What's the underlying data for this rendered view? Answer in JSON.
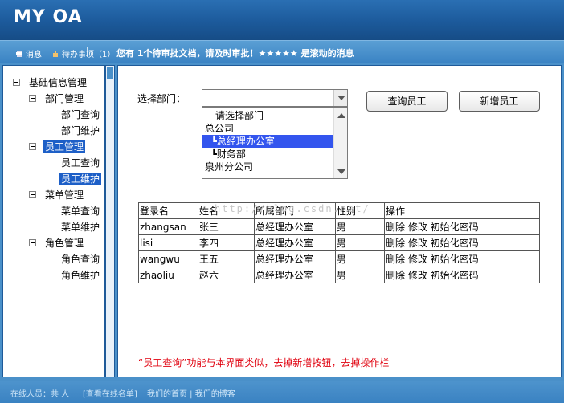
{
  "header": {
    "logo": "MY OA"
  },
  "notice_bar": {
    "messages_label": "消息",
    "todo_label": "待办事项（1）",
    "scroll_message": "您有 1个待审批文档，请及时审批！★★★★★ 是滚动的消息"
  },
  "sidebar": {
    "tree": [
      {
        "label": "基础信息管理",
        "level": 0,
        "toggle": true,
        "selected": false
      },
      {
        "label": "部门管理",
        "level": 1,
        "toggle": true,
        "selected": false
      },
      {
        "label": "部门查询",
        "level": 2,
        "toggle": false,
        "selected": false
      },
      {
        "label": "部门维护",
        "level": 2,
        "toggle": false,
        "selected": false
      },
      {
        "label": "员工管理",
        "level": 1,
        "toggle": true,
        "selected": true
      },
      {
        "label": "员工查询",
        "level": 2,
        "toggle": false,
        "selected": false
      },
      {
        "label": "员工维护",
        "level": 2,
        "toggle": false,
        "selected": true
      },
      {
        "label": "菜单管理",
        "level": 1,
        "toggle": true,
        "selected": false
      },
      {
        "label": "菜单查询",
        "level": 2,
        "toggle": false,
        "selected": false
      },
      {
        "label": "菜单维护",
        "level": 2,
        "toggle": false,
        "selected": false
      },
      {
        "label": "角色管理",
        "level": 1,
        "toggle": true,
        "selected": false
      },
      {
        "label": "角色查询",
        "level": 2,
        "toggle": false,
        "selected": false
      },
      {
        "label": "角色维护",
        "level": 2,
        "toggle": false,
        "selected": false
      }
    ]
  },
  "form": {
    "dept_label": "选择部门：",
    "select_value": "",
    "options": [
      {
        "label": "---请选择部门---",
        "highlighted": false
      },
      {
        "label": "总公司",
        "highlighted": false
      },
      {
        "label": "  ┗总经理办公室",
        "highlighted": true
      },
      {
        "label": "  ┗财务部",
        "highlighted": false
      },
      {
        "label": "泉州分公司",
        "highlighted": false
      }
    ],
    "query_button": "查询员工",
    "add_button": "新增员工"
  },
  "table": {
    "headers": [
      "登录名",
      "姓名",
      "所属部门",
      "性别",
      "操作"
    ],
    "rows": [
      [
        "zhangsan",
        "张三",
        "总经理办公室",
        "男",
        "删除 修改 初始化密码"
      ],
      [
        "lisi",
        "李四",
        "总经理办公室",
        "男",
        "删除 修改 初始化密码"
      ],
      [
        "wangwu",
        "王五",
        "总经理办公室",
        "男",
        "删除 修改 初始化密码"
      ],
      [
        "zhaoliu",
        "赵六",
        "总经理办公室",
        "男",
        "删除 修改 初始化密码"
      ]
    ]
  },
  "watermark": "http://blog.csdn.net/",
  "note": "“员工查询”功能与本界面类似，去掉新增按钮，去掉操作栏",
  "footer": {
    "online": "在线人员：共 人",
    "view_online": "[查看在线名单]",
    "links": "我们的首页 | 我们的博客"
  }
}
